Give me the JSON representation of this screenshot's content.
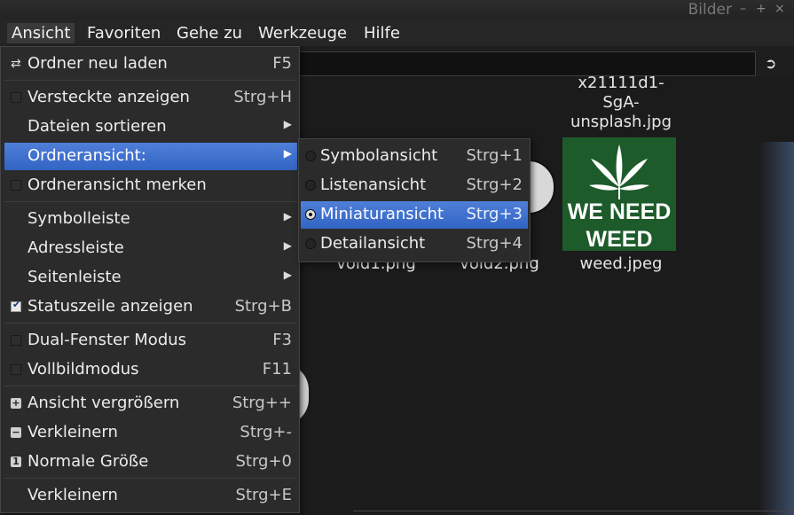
{
  "window": {
    "title": "Bilder",
    "controls": [
      "–",
      "+",
      "×"
    ]
  },
  "menubar": [
    "Ansicht",
    "Favoriten",
    "Gehe zu",
    "Werkzeuge",
    "Hilfe"
  ],
  "files": {
    "top_partial": "x21111d1-",
    "top_line2": "SgA-",
    "top_line3": "unsplash.jpg",
    "void1": "void1.png",
    "void2": "void2.png",
    "weed": "weed.jpeg",
    "weed_text_1": "WE NEED",
    "weed_text_2": "WEED"
  },
  "ansicht_menu": {
    "reload": {
      "label": "Ordner neu laden",
      "shortcut": "F5"
    },
    "hidden": {
      "label": "Versteckte anzeigen",
      "shortcut": "Strg+H"
    },
    "sort": {
      "label": "Dateien sortieren"
    },
    "folderview": {
      "label": "Ordneransicht:"
    },
    "remember": {
      "label": "Ordneransicht merken"
    },
    "toolbar": {
      "label": "Symbolleiste"
    },
    "addressbar": {
      "label": "Adressleiste"
    },
    "sidebar": {
      "label": "Seitenleiste"
    },
    "statusbar": {
      "label": "Statuszeile anzeigen",
      "shortcut": "Strg+B"
    },
    "dual": {
      "label": "Dual-Fenster Modus",
      "shortcut": "F3"
    },
    "fullscreen": {
      "label": "Vollbildmodus",
      "shortcut": "F11"
    },
    "zoomin": {
      "label": "Ansicht vergrößern",
      "shortcut": "Strg++"
    },
    "zoomout": {
      "label": "Verkleinern",
      "shortcut": "Strg+-"
    },
    "normal": {
      "label": "Normale Größe",
      "shortcut": "Strg+0"
    },
    "shrink": {
      "label": "Verkleinern",
      "shortcut": "Strg+E"
    }
  },
  "folderview_submenu": {
    "icon": {
      "label": "Symbolansicht",
      "shortcut": "Strg+1"
    },
    "list": {
      "label": "Listenansicht",
      "shortcut": "Strg+2"
    },
    "thumb": {
      "label": "Miniaturansicht",
      "shortcut": "Strg+3"
    },
    "detail": {
      "label": "Detailansicht",
      "shortcut": "Strg+4"
    }
  },
  "colors": {
    "highlight": "#3a6fd0",
    "menu_bg": "#2b2b2b",
    "weed_bg": "#1d5b2a"
  }
}
